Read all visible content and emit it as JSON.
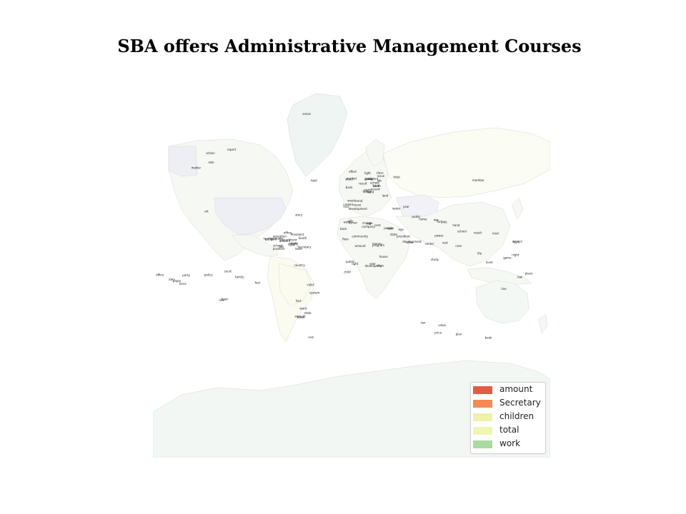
{
  "title": "SBA offers Administrative Management Courses",
  "legend": [
    {
      "label": "amount",
      "color": "#e45b45"
    },
    {
      "label": "Secretary",
      "color": "#f68a54"
    },
    {
      "label": "children",
      "color": "#eff2a8"
    },
    {
      "label": "total",
      "color": "#f0f6b0"
    },
    {
      "label": "work",
      "color": "#a8dba0"
    }
  ],
  "map": {
    "ocean_color": "#ffffff",
    "land_base_color": "#f6f8f4",
    "polar_color": "#f2f7f4",
    "labels": [
      "hand",
      "weed",
      "party",
      "center",
      "South",
      "trend",
      "class",
      "student",
      "issue",
      "record",
      "effort",
      "water",
      "bank",
      "total",
      "family",
      "job",
      "development",
      "group",
      "school",
      "week",
      "result",
      "rest",
      "house",
      "party",
      "area",
      "land",
      "market",
      "light",
      "world",
      "people",
      "South",
      "amount",
      "job",
      "Department",
      "operation",
      "President",
      "school",
      "issue",
      "Secretary",
      "body",
      "office",
      "public",
      "part",
      "case",
      "problem",
      "number",
      "money",
      "child",
      "development",
      "program",
      "public",
      "state",
      "back",
      "house",
      "city",
      "light",
      "Turner",
      "water",
      "year",
      "man",
      "job",
      "amount",
      "floor",
      "community",
      "people",
      "city",
      "cent",
      "company",
      "fact",
      "president",
      "power",
      "center",
      "school",
      "home",
      "development",
      "year",
      "public",
      "eye",
      "war",
      "rest",
      "side",
      "area",
      "hand",
      "result",
      "amount",
      "child",
      "fact",
      "state",
      "week",
      "word",
      "country",
      "system",
      "night",
      "law",
      "game",
      "place",
      "life",
      "line",
      "service",
      "type",
      "level",
      "kind",
      "family",
      "office",
      "idea",
      "paper",
      "force",
      "policy",
      "court",
      "party",
      "plan",
      "tax",
      "value",
      "price",
      "sense",
      "matter",
      "rate",
      "report",
      "action",
      "field",
      "role",
      "member",
      "change",
      "story",
      "study",
      "fact",
      "book",
      "rest",
      "care",
      "art",
      "town"
    ]
  }
}
